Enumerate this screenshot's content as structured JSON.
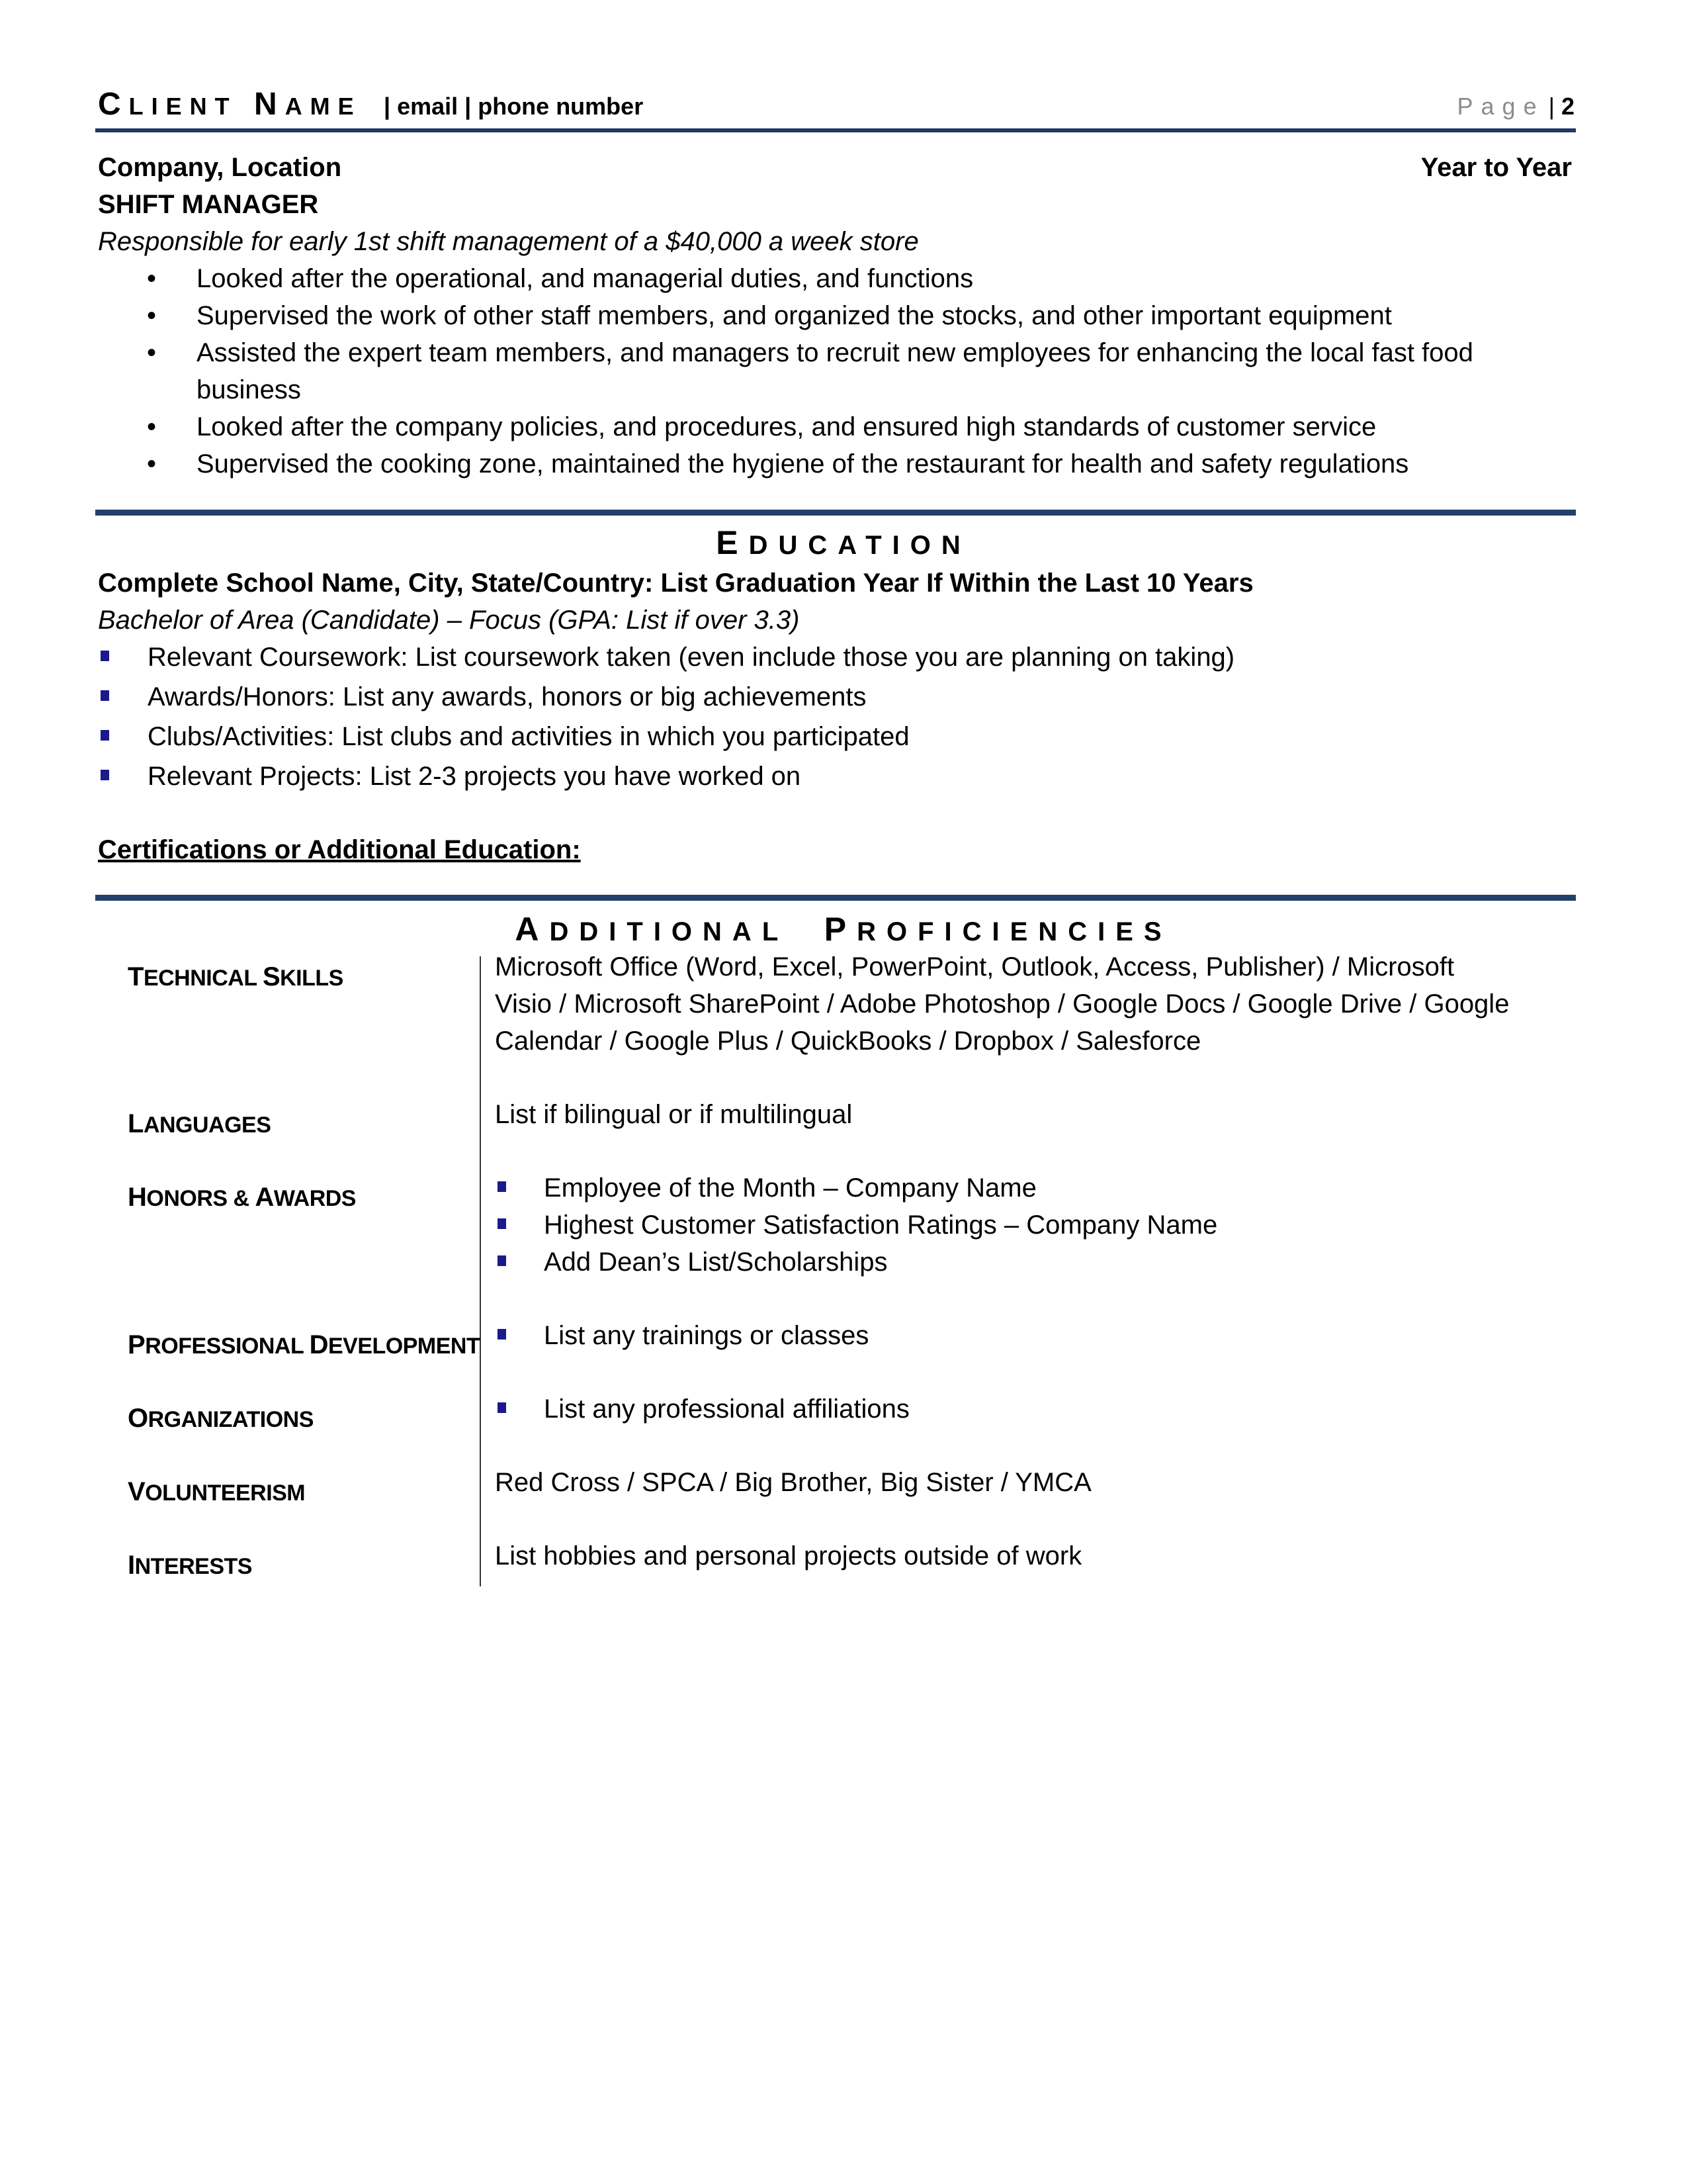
{
  "header": {
    "name_first_initial": "C",
    "name_first_rest": "LIENT",
    "name_last_initial": "N",
    "name_last_rest": "AME",
    "contact": "| email | phone number",
    "page_word": "Page",
    "page_sep": "|",
    "page_number": "2"
  },
  "experience": {
    "company_location": "Company, Location",
    "dates": "Year to Year",
    "title": "SHIFT MANAGER",
    "summary": "Responsible for early 1st shift management of a $40,000 a week store",
    "bullets": [
      "Looked after the operational, and managerial duties, and functions",
      "Supervised the work of other staff members, and organized the stocks, and other important equipment",
      "Assisted the expert team members, and managers to recruit new employees for enhancing the local fast food",
      "business",
      "Looked after the company policies, and procedures, and ensured high standards of customer service",
      "Supervised the cooking zone, maintained the hygiene of the restaurant for health and safety regulations"
    ],
    "bullet_glyph": "•"
  },
  "education": {
    "title_initial": "E",
    "title_rest": "DUCATION",
    "school_line": "Complete School Name, City, State/Country: List Graduation Year If Within the Last 10 Years",
    "degree_line": "Bachelor of Area (Candidate) – Focus (GPA:  List if over 3.3)",
    "bullets": [
      "Relevant Coursework:  List coursework taken (even include those you are planning on taking)",
      "Awards/Honors:  List any awards, honors or big achievements",
      "Clubs/Activities:  List clubs and activities in which you participated",
      "Relevant Projects:  List 2-3 projects you have worked on"
    ],
    "certifications_heading": "Certifications or Additional Education:"
  },
  "proficiencies": {
    "title_initial_1": "A",
    "title_rest_1": "DDITIONAL",
    "title_initial_2": "P",
    "title_rest_2": "ROFICIENCIES",
    "rows": [
      {
        "label_initial": "T",
        "label_rest": "ECHNICAL",
        "label_initial2": "S",
        "label_rest2": "KILLS",
        "lines": [
          "Microsoft Office (Word, Excel, PowerPoint, Outlook, Access, Publisher) / Microsoft",
          "Visio / Microsoft SharePoint / Adobe Photoshop / Google Docs / Google Drive / Google",
          "Calendar / Google Plus / QuickBooks / Dropbox / Salesforce"
        ]
      },
      {
        "label_initial": "L",
        "label_rest": "ANGUAGES",
        "lines": [
          "List if bilingual or if multilingual"
        ]
      },
      {
        "label_initial": "H",
        "label_rest": "ONORS",
        "label_amp": " & ",
        "label_initial2": "A",
        "label_rest2": "WARDS",
        "bullets": [
          "Employee of the Month – Company Name",
          "Highest Customer Satisfaction Ratings – Company Name",
          "Add Dean’s List/Scholarships"
        ]
      },
      {
        "label_initial": "P",
        "label_rest": "ROFESSIONAL",
        "label_initial2": "D",
        "label_rest2": "EVELOPMENT",
        "bullets": [
          "List any trainings or classes"
        ]
      },
      {
        "label_initial": "O",
        "label_rest": "RGANIZATIONS",
        "bullets": [
          "List any professional affiliations"
        ]
      },
      {
        "label_initial": "V",
        "label_rest": "OLUNTEERISM",
        "lines": [
          "Red Cross / SPCA / Big Brother, Big Sister / YMCA"
        ]
      },
      {
        "label_initial": "I",
        "label_rest": "NTERESTS",
        "lines": [
          "List hobbies and personal projects outside of work"
        ]
      }
    ]
  },
  "colors": {
    "rule": "#1f3864",
    "square_bullet": "#1a1a8c",
    "page_word": "#8c8c8c"
  }
}
